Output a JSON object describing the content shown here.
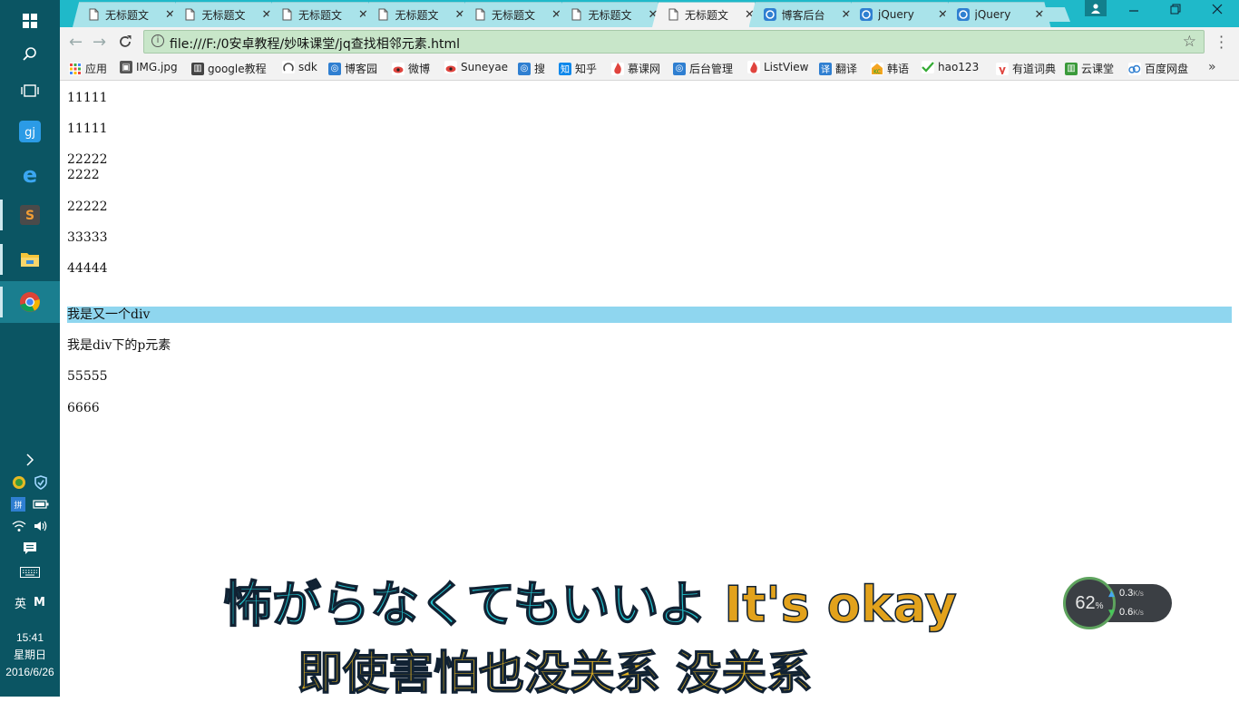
{
  "taskbar": {
    "clock_time": "15:41",
    "clock_day": "星期日",
    "clock_date": "2016/6/26",
    "ime_lang": "英",
    "ime_mode": "M"
  },
  "browser": {
    "tabs": [
      {
        "title": "无标题文",
        "icon": "page-icon"
      },
      {
        "title": "无标题文",
        "icon": "page-icon"
      },
      {
        "title": "无标题文",
        "icon": "page-icon"
      },
      {
        "title": "无标题文",
        "icon": "page-icon"
      },
      {
        "title": "无标题文",
        "icon": "page-icon"
      },
      {
        "title": "无标题文",
        "icon": "page-icon"
      },
      {
        "title": "无标题文",
        "icon": "page-icon",
        "active": true
      },
      {
        "title": "博客后台",
        "icon": "cnblogs-icon"
      },
      {
        "title": "jQuery",
        "icon": "cnblogs-icon"
      },
      {
        "title": "jQuery",
        "icon": "cnblogs-icon"
      }
    ],
    "url": "file:///F:/0安卓教程/妙味课堂/jq查找相邻元素.html",
    "bookmarks": [
      {
        "label": "应用",
        "icon": "apps-grid-icon"
      },
      {
        "label": "IMG.jpg",
        "icon": "image-icon"
      },
      {
        "label": "google教程",
        "icon": "book-icon"
      },
      {
        "label": "sdk",
        "icon": "android-icon"
      },
      {
        "label": "博客园",
        "icon": "cnblogs-icon"
      },
      {
        "label": "微博",
        "icon": "weibo-icon"
      },
      {
        "label": "Suneyae",
        "icon": "weibo-icon"
      },
      {
        "label": "搜",
        "icon": "cnblogs-icon"
      },
      {
        "label": "知乎",
        "icon": "zhihu-icon"
      },
      {
        "label": "慕课网",
        "icon": "fire-icon"
      },
      {
        "label": "后台管理",
        "icon": "cnblogs-icon"
      },
      {
        "label": "ListView",
        "icon": "fire-icon"
      },
      {
        "label": "翻译",
        "icon": "translate-icon"
      },
      {
        "label": "韩语",
        "icon": "kc-icon"
      },
      {
        "label": "hao123",
        "icon": "hao123-icon"
      },
      {
        "label": "有道词典",
        "icon": "youdao-icon"
      },
      {
        "label": "云课堂",
        "icon": "book-green-icon"
      },
      {
        "label": "百度网盘",
        "icon": "cloud-icon"
      }
    ]
  },
  "page": {
    "lines": [
      "11111",
      "11111",
      "22222",
      "2222",
      "22222",
      "33333",
      "44444",
      "我是又一个div",
      "我是div下的p元素",
      "55555",
      "6666"
    ],
    "highlight_color": "#8fd6ef"
  },
  "overlay": {
    "lyric_jp": "怖がらなくてもいいよ",
    "lyric_en": "It's okay",
    "lyric_cn": "即使害怕也没关系 没关系",
    "net_percent": "62",
    "net_percent_unit": "%",
    "net_up": "0.3",
    "net_down": "0.6",
    "net_unit": "K/s"
  },
  "colors": {
    "taskbar": "#0b5563",
    "tabstrip": "#1fb9c9",
    "omnibox": "#c8e6c9"
  }
}
